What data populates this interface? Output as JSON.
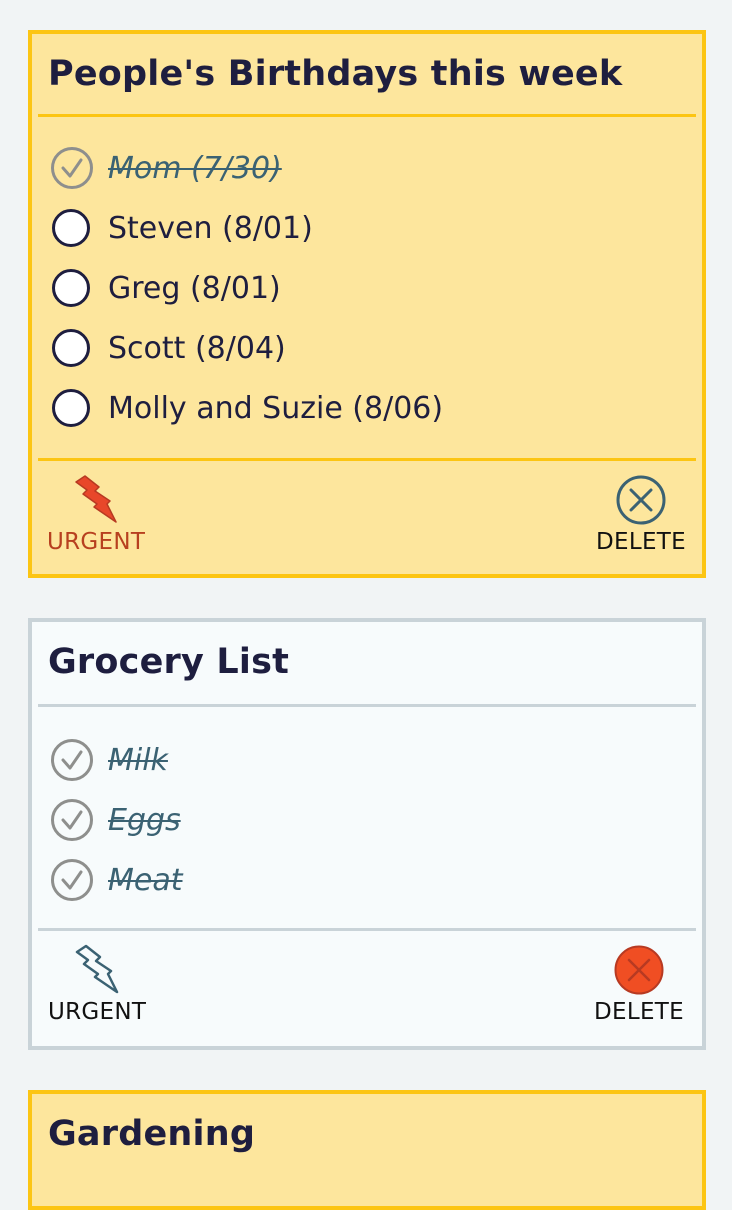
{
  "notes": [
    {
      "title": "People's Birthdays this week",
      "urgent": true,
      "tasks": [
        {
          "text": "Mom (7/30)",
          "done": true
        },
        {
          "text": "Steven (8/01)",
          "done": false
        },
        {
          "text": "Greg (8/01)",
          "done": false
        },
        {
          "text": "Scott (8/04)",
          "done": false
        },
        {
          "text": "Molly and Suzie (8/06)",
          "done": false
        }
      ],
      "urgent_label": "URGENT",
      "delete_label": "DELETE"
    },
    {
      "title": "Grocery List",
      "urgent": false,
      "tasks": [
        {
          "text": "Milk",
          "done": true
        },
        {
          "text": "Eggs",
          "done": true
        },
        {
          "text": "Meat",
          "done": true
        }
      ],
      "urgent_label": "URGENT",
      "delete_label": "DELETE"
    },
    {
      "title": "Gardening",
      "urgent": true
    }
  ],
  "icons": {
    "done": "check-circle-icon",
    "todo": "empty-circle-icon",
    "urgent": "lightning-bolt-icon",
    "delete": "x-circle-icon"
  },
  "colors": {
    "urgent_bg": "#fde69d",
    "urgent_border": "#fcc513",
    "normal_bg": "#f7fbfc",
    "normal_border": "#c9d3d8",
    "urgent_active": "#e8472a",
    "delete_active": "#f04e23",
    "text_dark": "#1e1e3f",
    "done_text": "#3b6273"
  }
}
